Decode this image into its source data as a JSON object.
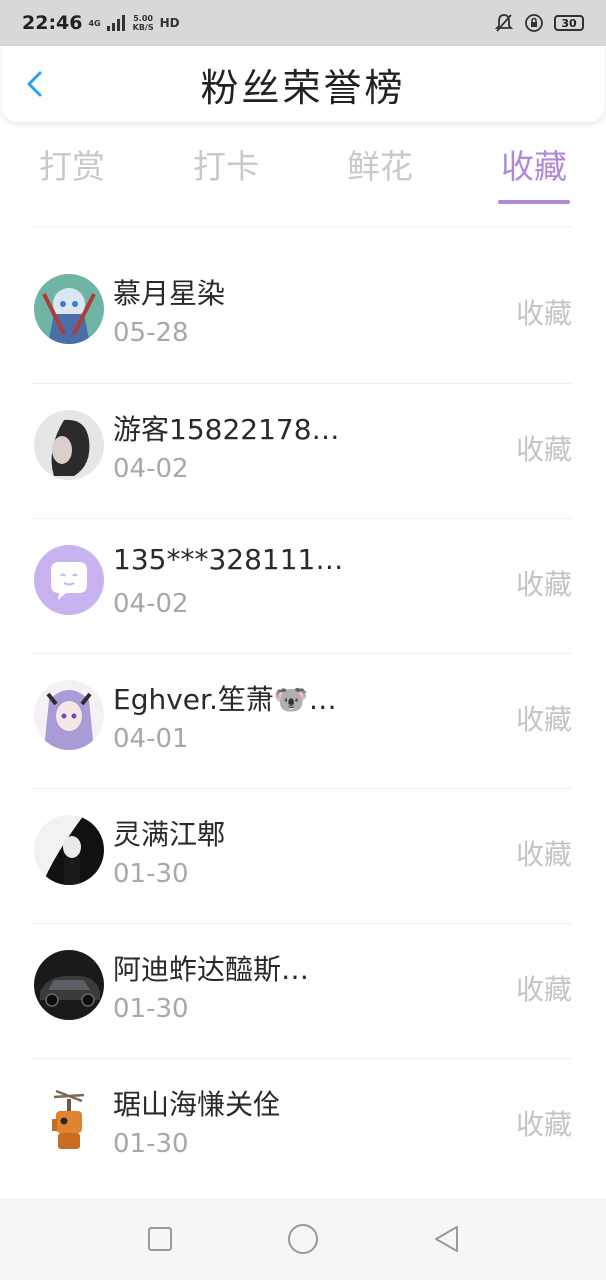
{
  "status": {
    "time": "22:46",
    "net_type": "4G",
    "speed": "5.00",
    "speed_unit": "KB/S",
    "hd": "HD",
    "battery": "30"
  },
  "header": {
    "title": "粉丝荣誉榜"
  },
  "tabs": [
    {
      "label": "打赏",
      "active": false
    },
    {
      "label": "打卡",
      "active": false
    },
    {
      "label": "鲜花",
      "active": false
    },
    {
      "label": "收藏",
      "active": true
    }
  ],
  "fans": [
    {
      "name": "慕月星染",
      "date": "05-28",
      "action": "收藏"
    },
    {
      "name": "游客15822178…",
      "date": "04-02",
      "action": "收藏"
    },
    {
      "name": "135***328111…",
      "date": "04-02",
      "action": "收藏"
    },
    {
      "name": "Eghver.笙萧🐨…",
      "date": "04-01",
      "action": "收藏"
    },
    {
      "name": "灵满江郫",
      "date": "01-30",
      "action": "收藏"
    },
    {
      "name": "阿迪蚱达醯斯…",
      "date": "01-30",
      "action": "收藏"
    },
    {
      "name": "琚山海慊关佺",
      "date": "01-30",
      "action": "收藏"
    }
  ],
  "colors": {
    "accent": "#b08ad9",
    "back_arrow": "#2a9df4"
  }
}
